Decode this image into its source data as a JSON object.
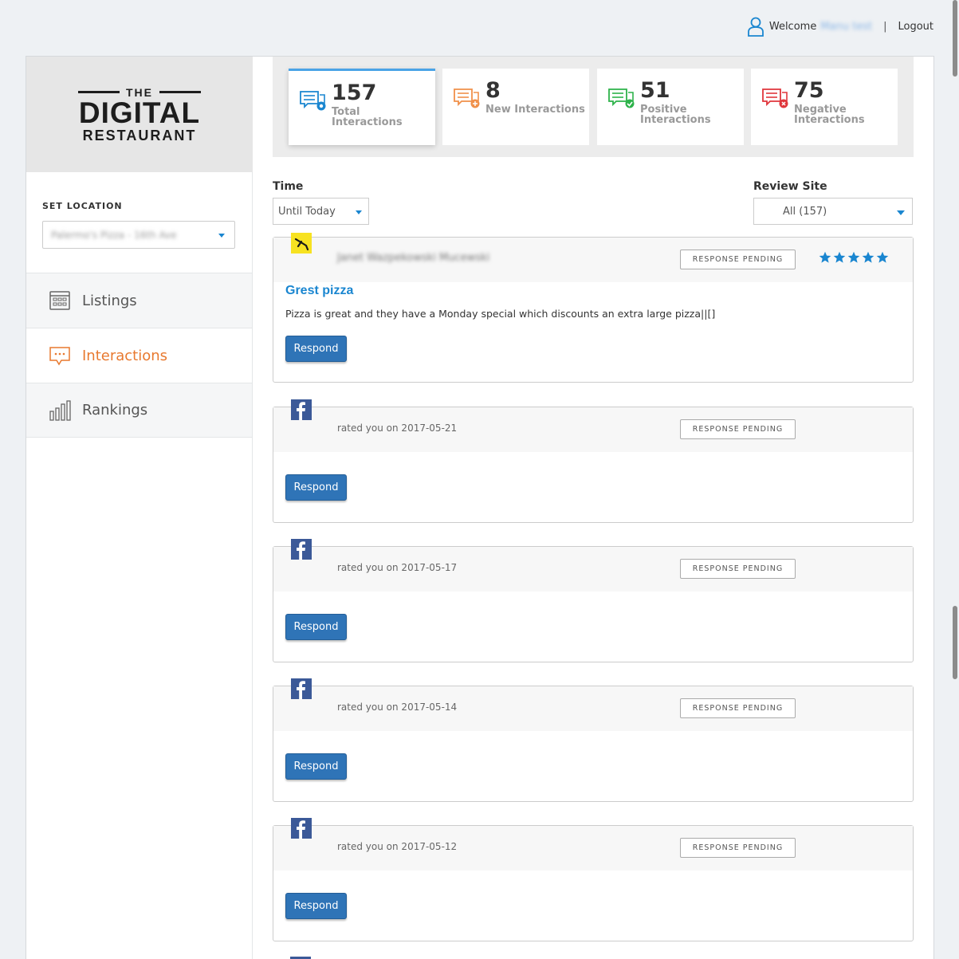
{
  "header": {
    "welcome": "Welcome",
    "user_name": "Manu test",
    "separator": "|",
    "logout": "Logout"
  },
  "sidebar": {
    "logo": {
      "the": "THE",
      "digital": "DIGITAL",
      "restaurant": "RESTAURANT"
    },
    "set_location_label": "SET LOCATION",
    "location_value": "Palermo's Pizza - 16th Ave",
    "nav": [
      {
        "label": "Listings",
        "icon": "grid-calendar-icon"
      },
      {
        "label": "Interactions",
        "icon": "chat-bubble-icon",
        "active": true
      },
      {
        "label": "Rankings",
        "icon": "bar-chart-icon"
      }
    ]
  },
  "stats": [
    {
      "value": "157",
      "label": "Total Interactions",
      "color": "#1a86d0",
      "active": true
    },
    {
      "value": "8",
      "label": "New Interactions",
      "color": "#f0904a"
    },
    {
      "value": "51",
      "label": "Positive Interactions",
      "color": "#2db24a"
    },
    {
      "value": "75",
      "label": "Negative Interactions",
      "color": "#e0363c"
    }
  ],
  "filters": {
    "time_label": "Time",
    "time_value": "Until Today",
    "site_label": "Review Site",
    "site_value": "All (157)"
  },
  "reviews": [
    {
      "source": "yellowpages",
      "reviewer": "Janet Wazpekowski Mucewski",
      "status": "RESPONSE PENDING",
      "rating": 5,
      "title": "Grest pizza",
      "text": "Pizza is great and they have a Monday special which discounts an extra large pizza||[]",
      "action": "Respond"
    },
    {
      "source": "facebook",
      "rated": "rated you on 2017-05-21",
      "status": "RESPONSE PENDING",
      "action": "Respond"
    },
    {
      "source": "facebook",
      "rated": "rated you on 2017-05-17",
      "status": "RESPONSE PENDING",
      "action": "Respond"
    },
    {
      "source": "facebook",
      "rated": "rated you on 2017-05-14",
      "status": "RESPONSE PENDING",
      "action": "Respond"
    },
    {
      "source": "facebook",
      "rated": "rated you on 2017-05-12",
      "status": "RESPONSE PENDING",
      "action": "Respond"
    }
  ],
  "colors": {
    "accent_blue": "#1a86d0",
    "button_blue": "#2f74b7",
    "active_nav": "#e8792f",
    "star_blue": "#1a86d0"
  }
}
